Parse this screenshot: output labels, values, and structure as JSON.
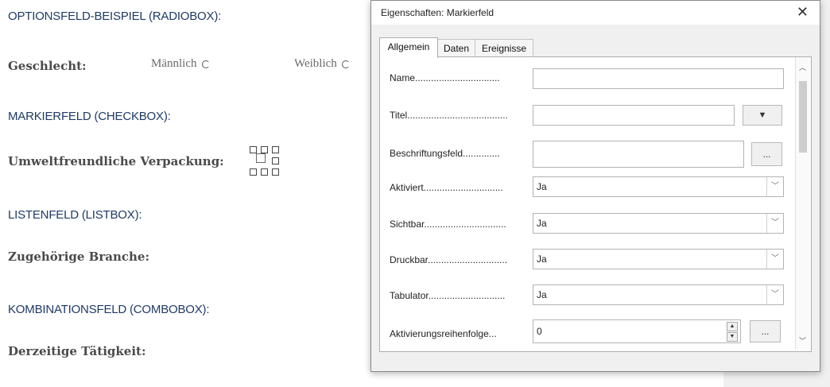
{
  "document": {
    "sections": {
      "radiobox_heading": "OPTIONSFELD-BEISPIEL (RADIOBOX):",
      "checkbox_heading": "MARKIERFELD (CHECKBOX):",
      "listbox_heading": "LISTENFELD (LISTBOX):",
      "combobox_heading": "KOMBINATIONSFELD (COMBOBOX):"
    },
    "labels": {
      "gender": "Geschlecht:",
      "packaging": "Umweltfreundliche Verpackung:",
      "industry": "Zugehörige Branche:",
      "activity": "Derzeitige Tätigkeit:"
    },
    "options": {
      "male": "Männlich",
      "female": "Weiblich"
    }
  },
  "dialog": {
    "title": "Eigenschaften: Markierfeld",
    "close_icon": "close-icon",
    "tabs": [
      {
        "label": "Allgemein",
        "active": true
      },
      {
        "label": "Daten",
        "active": false
      },
      {
        "label": "Ereignisse",
        "active": false
      }
    ],
    "rows": [
      {
        "label": "Name................................",
        "value": ""
      },
      {
        "label": "Titel......................................",
        "value": ""
      },
      {
        "label": "Beschriftungsfeld..............",
        "value": "",
        "button": "..."
      },
      {
        "label": "Aktiviert..............................",
        "value": "Ja"
      },
      {
        "label": "Sichtbar...............................",
        "value": "Ja"
      },
      {
        "label": "Druckbar..............................",
        "value": "Ja"
      },
      {
        "label": "Tabulator.............................",
        "value": "Ja"
      },
      {
        "label": "Aktivierungsreihenfolge...",
        "value": "0",
        "button": "..."
      }
    ]
  }
}
